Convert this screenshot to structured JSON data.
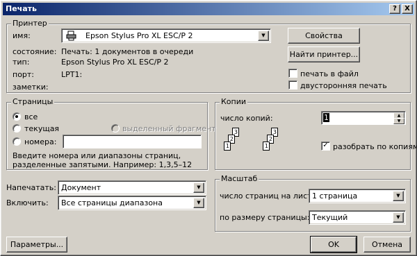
{
  "window": {
    "title": "Печать",
    "help_label": "?",
    "close_label": "X"
  },
  "printer": {
    "group_title": "Принтер",
    "name_label": "имя:",
    "name_value": "Epson Stylus Pro XL ESC/P 2",
    "status_label": "состояние:",
    "status_value": "Печать: 1 документов в очереди",
    "type_label": "тип:",
    "type_value": "Epson Stylus Pro XL ESC/P 2",
    "port_label": "порт:",
    "port_value": "LPT1:",
    "notes_label": "заметки:",
    "notes_value": "",
    "properties_button": "Свойства",
    "find_button": "Найти принтер...",
    "print_to_file_label": "печать в файл",
    "print_to_file_checked": false,
    "duplex_label": "двусторонняя печать",
    "duplex_checked": false
  },
  "pages": {
    "group_title": "Страницы",
    "all_label": "все",
    "current_label": "текущая",
    "selection_label": "выделенный фрагмент",
    "numbers_label": "номера:",
    "numbers_value": "",
    "selected_option": "все",
    "hint_text": "Введите номера или диапазоны страниц, разделенные запятыми. Например: 1,3,5–12"
  },
  "copies": {
    "group_title": "Копии",
    "count_label": "число копий:",
    "count_value": "1",
    "collate_label": "разобрать по копиям",
    "collate_checked": true,
    "collate_icon": "collate-pages-icon",
    "page_labels": [
      "1",
      "2",
      "3"
    ]
  },
  "print_what": {
    "label": "Напечатать:",
    "value": "Документ"
  },
  "include": {
    "label": "Включить:",
    "value": "Все страницы диапазона"
  },
  "scale": {
    "group_title": "Масштаб",
    "pages_per_sheet_label": "число страниц на листе:",
    "pages_per_sheet_value": "1 страница",
    "fit_to_label": "по размеру страницы:",
    "fit_to_value": "Текущий"
  },
  "footer": {
    "options_button": "Параметры...",
    "ok_button": "OK",
    "cancel_button": "Отмена"
  },
  "colors": {
    "face": "#d4d0c8",
    "title_start": "#0a246a",
    "title_end": "#a6caf0"
  }
}
